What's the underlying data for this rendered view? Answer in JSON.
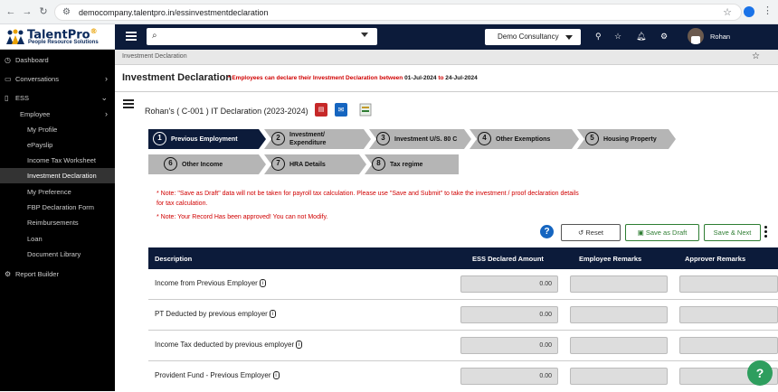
{
  "browser": {
    "url": "democompany.talentpro.in/essinvestmentdeclaration"
  },
  "logo": {
    "brand": "TalentPro",
    "reg": "®",
    "tagline": "People Resource Solutions"
  },
  "sidebar": {
    "items": [
      {
        "label": "Dashboard",
        "icon": "clock-icon"
      },
      {
        "label": "Conversations",
        "icon": "chat-icon"
      },
      {
        "label": "ESS",
        "icon": "ess-icon"
      },
      {
        "label": "Employee"
      },
      {
        "label": "My Profile"
      },
      {
        "label": "ePayslip"
      },
      {
        "label": "Income Tax Worksheet"
      },
      {
        "label": "Investment Declaration"
      },
      {
        "label": "My Preference"
      },
      {
        "label": "FBP Declaration Form"
      },
      {
        "label": "Reimbursements"
      },
      {
        "label": "Loan"
      },
      {
        "label": "Document Library"
      },
      {
        "label": "Report Builder",
        "icon": "report-icon"
      }
    ]
  },
  "topbar": {
    "search_placeholder": "",
    "company": "Demo Consultancy",
    "user": "Rohan"
  },
  "breadcrumb": "Investment Declaration",
  "page": {
    "title": "Investment Declaration",
    "note_prefix": "* Employees can declare their Investment Declaration between",
    "date_from": "01-Jul-2024",
    "note_to": "to",
    "date_to": "24-Jul-2024",
    "declaration_title": "Rohan's ( C-001 ) IT Declaration (2023-2024)"
  },
  "steps": [
    {
      "num": "1",
      "label": "Previous Employment",
      "active": true
    },
    {
      "num": "2",
      "label": "Investment/ Expenditure"
    },
    {
      "num": "3",
      "label": "Investment U/S. 80 C"
    },
    {
      "num": "4",
      "label": "Other Exemptions"
    },
    {
      "num": "5",
      "label": "Housing Property"
    },
    {
      "num": "6",
      "label": "Other Income"
    },
    {
      "num": "7",
      "label": "HRA Details"
    },
    {
      "num": "8",
      "label": "Tax regime"
    }
  ],
  "notes": {
    "draft": "* Note: \"Save as Draft\" data will not be taken for payroll tax calculation. Please use \"Save and Submit\" to take the investment / proof declaration details for tax calculation.",
    "approved": "* Note: Your Record Has been approved! You can not Modify."
  },
  "buttons": {
    "reset": "Reset",
    "save_draft": "Save as Draft",
    "save_next": "Save & Next",
    "help": "?"
  },
  "table": {
    "headers": [
      "Description",
      "ESS Declared Amount",
      "Employee Remarks",
      "Approver Remarks"
    ],
    "rows": [
      {
        "desc": "Income from Previous Employer",
        "amount": "0.00"
      },
      {
        "desc": "PT Deducted by previous employer",
        "amount": "0.00"
      },
      {
        "desc": "Income Tax deducted by previous employer",
        "amount": "0.00"
      },
      {
        "desc": "Provident Fund - Previous Employer",
        "amount": "0.00"
      }
    ]
  },
  "colors": {
    "navy": "#0c1b3a",
    "green": "#2e7d32",
    "red": "#d00000"
  }
}
